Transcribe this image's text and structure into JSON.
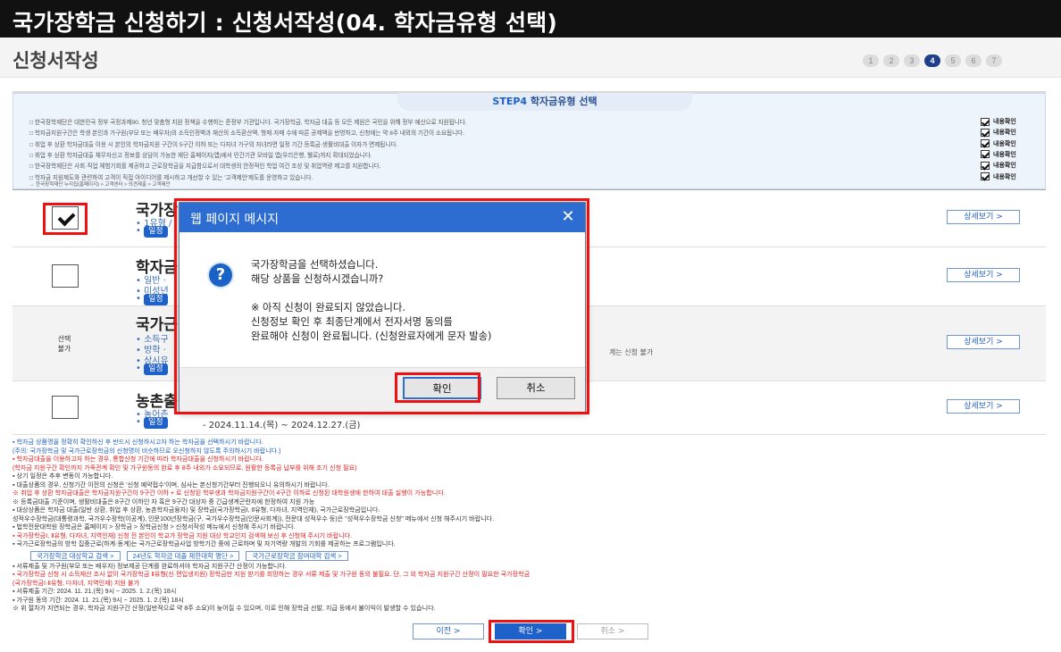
{
  "title_bar": {
    "text": "국가장학금 신청하기 : 신청서작성(04. 학자금유형 선택)"
  },
  "page": {
    "heading": "신청서작성",
    "steps": [
      "1",
      "2",
      "3",
      "4",
      "5",
      "6",
      "7"
    ],
    "active_step": "4"
  },
  "step4": {
    "label_prefix": "STEP4",
    "label": "학자금유형 선택",
    "notices": [
      {
        "text": "□ 한국장학재단은 대한민국 정부 국정과제90. 청년 맞춤형 지원 정책을 수행하는 준정부 기관입니다. 국가장학금, 학자금 대출 등 모든 제원은 국민을 위해 정부 예산으로 지원됩니다.",
        "check": "내용확인"
      },
      {
        "text": "□ 학자금지원구간은 학생 본인과 가구원(부모 또는 배우자)의 소득인정액과 재산의 소득환산액, 형제·자매 수에 따른 공제액을 반영하고, 신청에는 약 8주 내외의 기간이 소요됩니다.",
        "check": "내용확인"
      },
      {
        "text": "□ 취업 후 상환 학자금대출 이용 시 본인의 학자금지원 구간이 5구간 이하 또는 다자녀 가구의 자녀라면 일정 기간 등록금·생활비대출 이자가 면제됩니다.",
        "check": "내용확인"
      },
      {
        "text": "□ 취업 후 상환 학자금대출 채무자신고 정보를 상담이 가능한 재단 홈페이지(앱)에서 민간기관 모바일 앱(우리은행, 웰로)까지 확대되었습니다.",
        "check": "내용확인"
      },
      {
        "text": "□ 한국장학재단은 사회·직업 체험기회를 제공하고 근로장학금을 지급함으로서 대학생의 안정적인 학업 여건 조성 및 취업역량 제고를 지원합니다.",
        "check": "내용확인"
      },
      {
        "text": "□ 학자금 지원제도와 관련하여 고객이 직접 아이디어를 제시하고 개선할 수 있는 '고객제안'제도를 운영하고 있습니다.",
        "check": "내용확인"
      }
    ],
    "notice_subline": "→ 한국장학재단 누리집(홈페이지) > 고객센터 > 의견제출 > 고객제안"
  },
  "rows": [
    {
      "title": "국가장",
      "sub1": "• 1유형 /",
      "pill": "일정",
      "date": "",
      "checked": true,
      "detail": "상세보기 >"
    },
    {
      "title": "학자금",
      "sub1": "• 일반 ·",
      "sub2": "• 미성년",
      "pill": "일정",
      "date": "",
      "checked": false,
      "detail": "상세보기 >"
    },
    {
      "title": "국가근",
      "sub1": "• 소득구",
      "sub2": "• 방학 ·",
      "sub3": "• 상시유",
      "pill": "일정",
      "extra": "계는 신청 불가",
      "nosel": "선택\n불가",
      "detail": "상세보기 >"
    },
    {
      "title": "농촌출",
      "sub1": "• 농어촌",
      "pill": "일정",
      "date": "- 2024.11.14.(목) ~ 2024.12.27.(금)",
      "checked": false,
      "detail": "상세보기 >"
    }
  ],
  "bottom_notes": [
    {
      "cls": "blue",
      "text": "▪ 학자금 상품명을 정확히 확인하신 후 반드시 신청하시고자 하는 학자금을 선택하시기 바랍니다."
    },
    {
      "cls": "blue",
      "text": "  (주의: 국가장학금 및 국가근로장학금의 신청명이 비슷하므로 오신청하지 않도록 주의하시기 바랍니다.)"
    },
    {
      "cls": "red",
      "text": "▪ 학자금대출을 이용하고자 하는 경우, 통합신청 기간에 따라 학자금대출을 신청하시기 바랍니다."
    },
    {
      "cls": "red",
      "text": "  (학자금 지원구간 확인까지 가족관계 확인 및 가구원동의 완료 후 8주 내외가 소요되므로, 원활한 등록금 납부를 위해 조기 신청 필요)"
    },
    {
      "cls": "",
      "text": "▪ 상기 일정은 추후 변동이 가능합니다."
    },
    {
      "cls": "",
      "text": "▪ 대출상품의 경우, 신청기간 이전의 신청은 '신청 예약접수'이며, 심사는 본신청기간부터 진행되오니 유의하시기 바랍니다."
    },
    {
      "cls": "red",
      "text": "※ 취업 후 상환 학자금대출은 학자금지원구간이 9구간 이하 + 로 신청된 학부생과 학자금지원구간이 4구간 이하로 신청된 대학원생에 한하여 대출 실행이 가능합니다."
    },
    {
      "cls": "",
      "text": "  ※ 등록금대출 기준이며, 생활비대출은 8구간 이하인 자 혹은 9구간 대상자 중 긴급생계곤란자에 한정하여 지원 가능"
    },
    {
      "cls": "",
      "text": "▪ 대상상품은 학자금 대출(일반 상환, 취업 후 상환, 농촌학자금융자) 및 장학금(국가장학금Ⅰ, Ⅱ유형, 다자녀, 지역인재), 국가근로장학금입니다."
    },
    {
      "cls": "",
      "text": "  성적우수장학금(대통령과학, 국가우수장학(이공계), 인문100년장학금(구, 국가우수장학금(인문사회계)), 전문대 성적우수 등)은 \"성적우수장학금 신청\" 메뉴에서 신청 해주시기 바랍니다."
    },
    {
      "cls": "",
      "text": "▪ 법학전문대학원 장학금은 홈페이지 > 장학금 > 장학금신청 > 신청서작성 메뉴에서 신청해 주시기 바랍니다."
    },
    {
      "cls": "red",
      "text": "▪ 국가장학금Ⅰ, Ⅱ유형, 다자녀, 지역인재) 신청 전 본인이 학교가 장학금 지원 대상 학교인지 검색해 보신 후 신청해 주시기 바랍니다."
    },
    {
      "cls": "",
      "text": "▪ 국가근로장학금의 방학 집중근로(하계·동계)는 국가근로장학금사업 방학기간 중에 근로하며 및 자기역량 개발의 기회를 제공하는 프로그램입니다."
    }
  ],
  "link_buttons": [
    "국가장학금 대상학교 검색 >",
    "24년도 학자금 대출 제한대학 명단 >",
    "국가근로장학금 참여대학 검색 >"
  ],
  "bottom_notes2": [
    {
      "cls": "",
      "text": "▪ 서류제출 및 가구원(부모 또는 배우자) 정보제공 단계를 완료하셔야 학자금 지원구간 산정이 가능합니다."
    },
    {
      "cls": "red",
      "text": "▪ 국가장학금 신청 시 소득재산 조사 없이 국가장학금 Ⅱ유형(신·편입생지원) 장학금만 지원 받기를 희망하는 경우 서류 제출 및 가구원 동의 불필요. 단, 그 외 학자금 지원구간 산정이 필요한 국가장학금"
    },
    {
      "cls": "red",
      "text": "  (국가장학금Ⅰ·Ⅱ유형, 다자녀, 지역인재) 지원 불가"
    },
    {
      "cls": "",
      "text": "▪ 서류제출 기간: 2024. 11. 21.(목) 9시 ~ 2025. 1. 2.(목) 18시"
    },
    {
      "cls": "",
      "text": "▪ 가구원 동의 기간: 2024. 11. 21.(목) 9시 ~ 2025. 1. 2.(목) 18시"
    },
    {
      "cls": "",
      "text": "  ※ 위 절차가 지연되는 경우, 학자금 지원구간 산정(일반적으로 약 8주 소요)이 늦어질 수 있으며, 이로 인해 장학금 선발, 지급 등에서 불이익이 발생할 수 있습니다."
    }
  ],
  "bottom_buttons": {
    "prev": "이전 >",
    "ok": "확인 >",
    "cancel": "취소 >"
  },
  "dialog": {
    "title": "웹 페이지 메시지",
    "close": "✕",
    "icon": "?",
    "lines": [
      "국가장학금을 선택하셨습니다.",
      "해당 상품을 신청하시겠습니까?",
      "",
      "※ 아직 신청이 완료되지 않았습니다.",
      "신청정보 확인 후 최종단계에서 전자서명 동의를",
      "완료해야 신청이 완료됩니다. (신청완료자에게 문자 발송)"
    ],
    "ok": "확인",
    "cancel": "취소"
  }
}
